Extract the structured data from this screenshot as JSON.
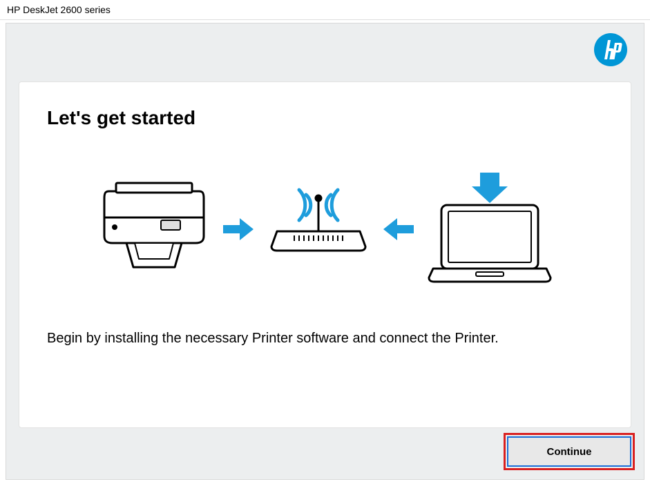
{
  "window": {
    "title": "HP DeskJet 2600 series"
  },
  "main": {
    "heading": "Let's get started",
    "body_text": "Begin by installing the necessary Printer software and connect the Printer."
  },
  "actions": {
    "continue_label": "Continue"
  },
  "colors": {
    "hp_blue": "#0096d6",
    "arrow_blue": "#1e9ddc"
  }
}
